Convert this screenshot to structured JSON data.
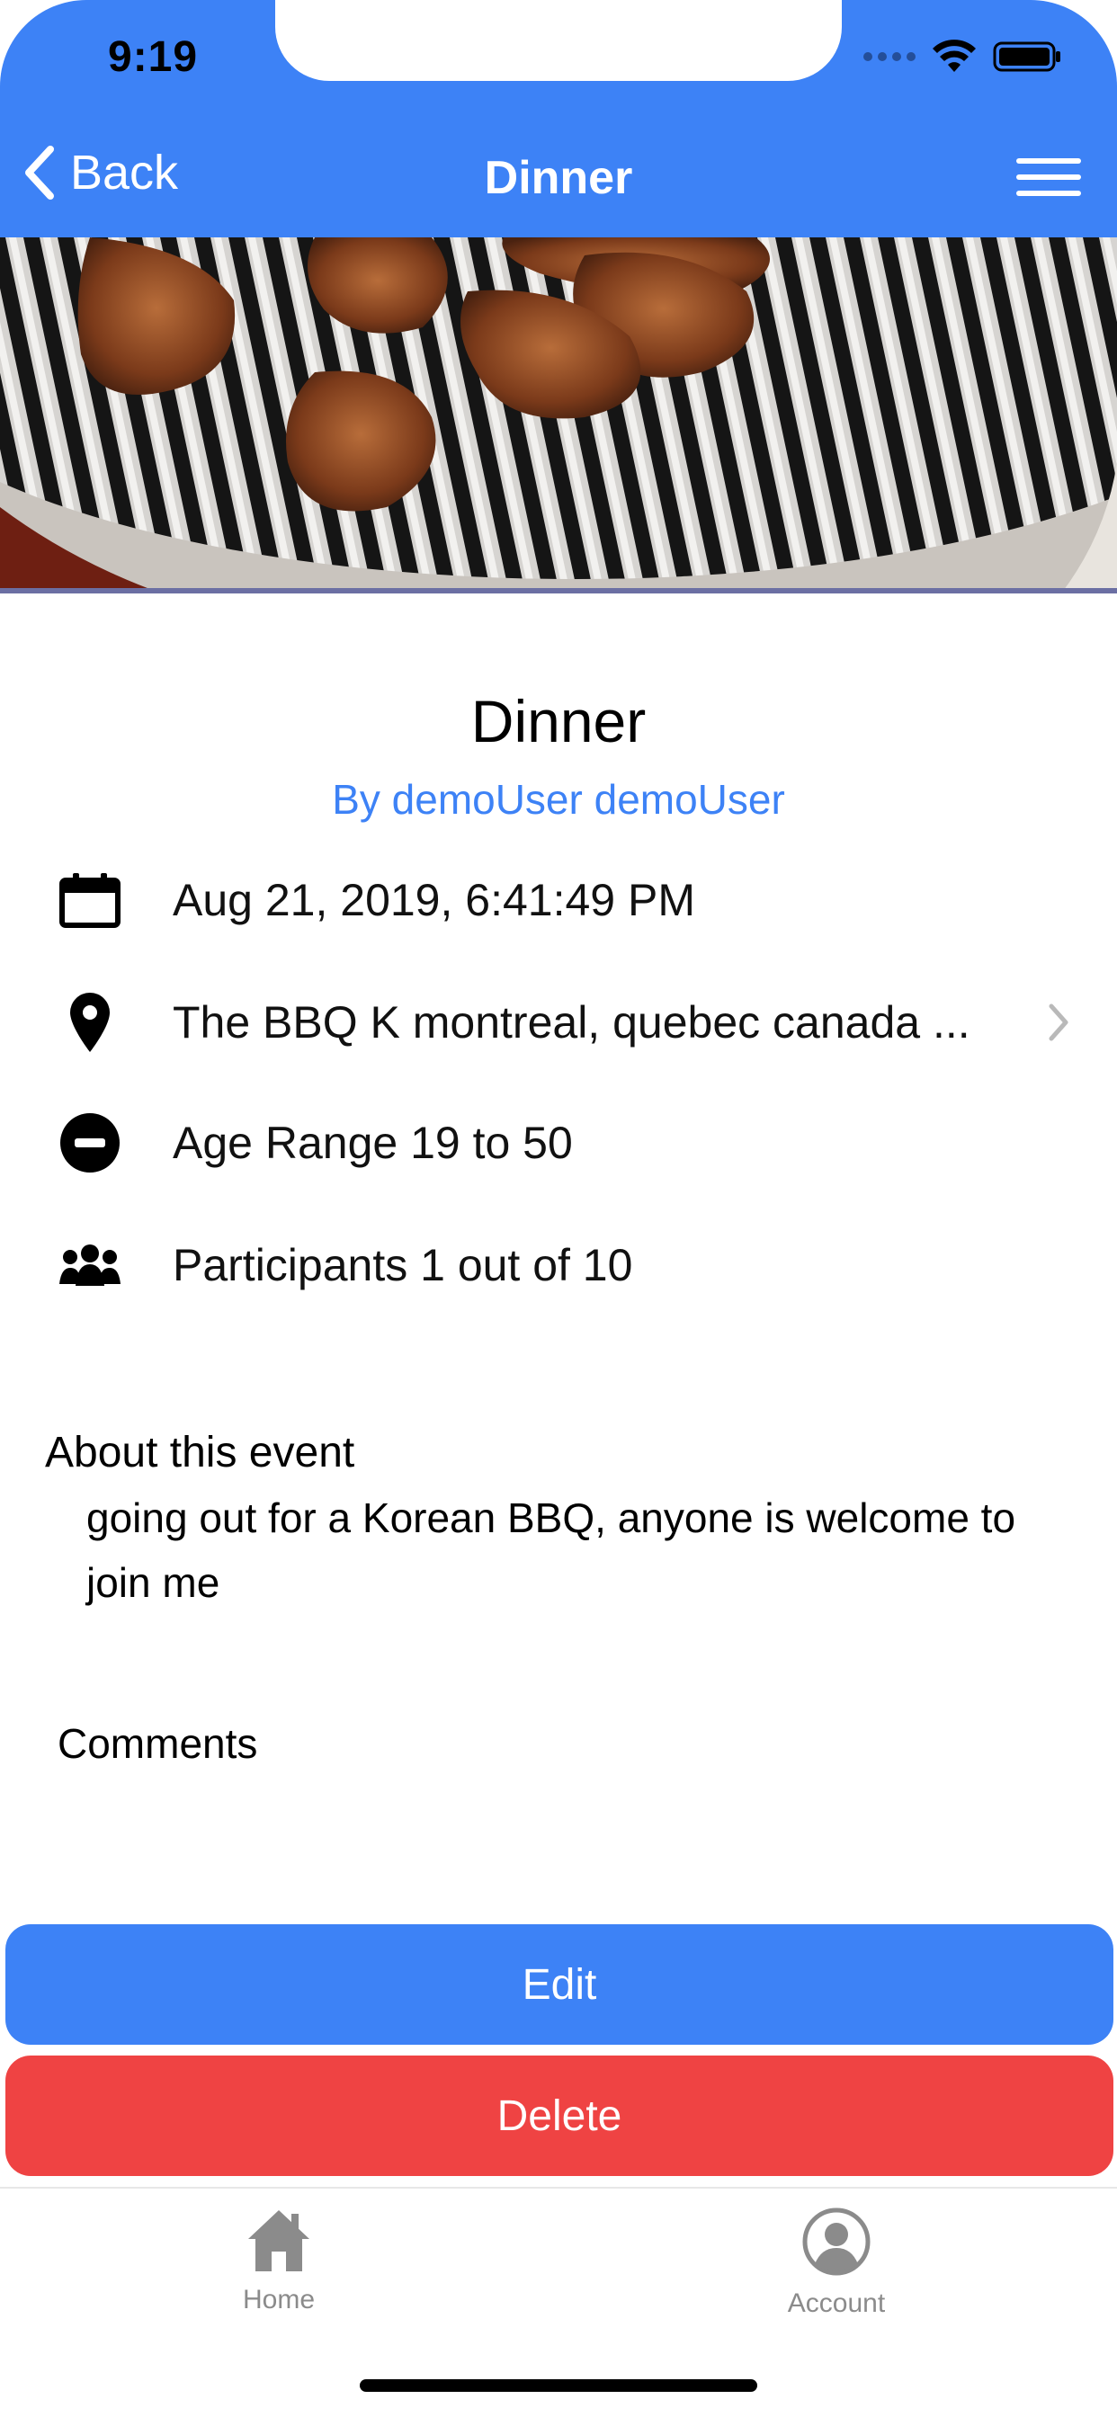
{
  "status_bar": {
    "time": "9:19"
  },
  "nav": {
    "back_label": "Back",
    "title": "Dinner"
  },
  "event": {
    "title": "Dinner",
    "byline": "By demoUser demoUser",
    "date": "Aug 21, 2019, 6:41:49 PM",
    "location": "The BBQ K montreal, quebec canada ...",
    "age_range": "Age Range 19 to 50",
    "participants": "Participants 1 out of 10",
    "about_heading": "About this event",
    "about_body": "going out for a Korean BBQ, anyone is welcome to join me",
    "comments_heading": "Comments"
  },
  "actions": {
    "edit_label": "Edit",
    "delete_label": "Delete"
  },
  "tabbar": {
    "home_label": "Home",
    "account_label": "Account"
  },
  "colors": {
    "accent": "#3d82f6",
    "danger": "#ef4343",
    "tab_inactive": "#8b8b8b"
  },
  "icons": [
    "chevron-left-icon",
    "menu-icon",
    "calendar-icon",
    "location-pin-icon",
    "minus-circle-icon",
    "group-icon",
    "chevron-right-icon",
    "home-icon",
    "account-icon"
  ]
}
